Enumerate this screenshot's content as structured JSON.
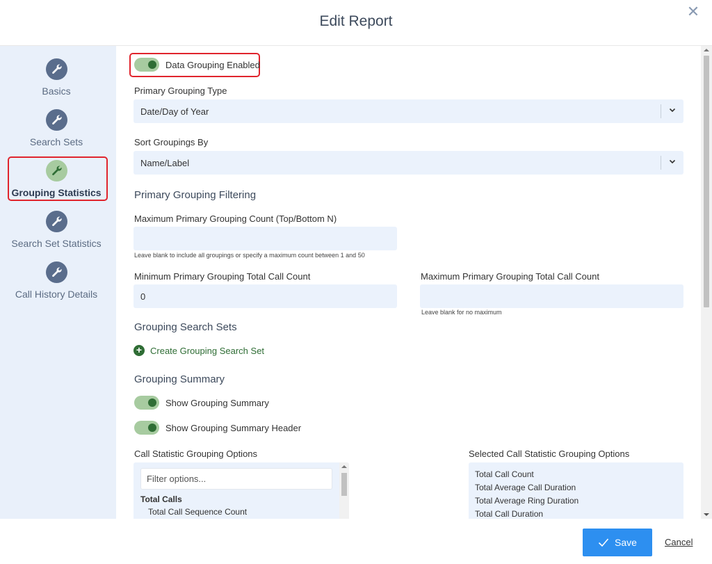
{
  "dialog": {
    "title": "Edit Report",
    "close_icon": "close-icon"
  },
  "sidebar": {
    "items": [
      {
        "label": "Basics",
        "icon": "wrench-icon"
      },
      {
        "label": "Search Sets",
        "icon": "wrench-icon"
      },
      {
        "label": "Grouping Statistics",
        "icon": "wrench-icon",
        "active": true
      },
      {
        "label": "Search Set Statistics",
        "icon": "wrench-icon"
      },
      {
        "label": "Call History Details",
        "icon": "wrench-icon"
      }
    ]
  },
  "main": {
    "data_grouping_toggle": {
      "label": "Data Grouping Enabled",
      "on": true
    },
    "primary_grouping_type": {
      "label": "Primary Grouping Type",
      "value": "Date/Day of Year"
    },
    "sort_groupings_by": {
      "label": "Sort Groupings By",
      "value": "Name/Label"
    },
    "filtering_section_title": "Primary Grouping Filtering",
    "max_count": {
      "label": "Maximum Primary Grouping Count (Top/Bottom N)",
      "value": "",
      "hint": "Leave blank to include all groupings or specify a maximum count between 1 and 50"
    },
    "min_total_call_count": {
      "label": "Minimum Primary Grouping Total Call Count",
      "value": "0"
    },
    "max_total_call_count": {
      "label": "Maximum Primary Grouping Total Call Count",
      "value": "",
      "hint": "Leave blank for no maximum"
    },
    "search_sets_section_title": "Grouping Search Sets",
    "create_search_set_link": "Create Grouping Search Set",
    "summary_section_title": "Grouping Summary",
    "show_summary_toggle": {
      "label": "Show Grouping Summary",
      "on": true
    },
    "show_summary_header_toggle": {
      "label": "Show Grouping Summary Header",
      "on": true
    },
    "options_list": {
      "label": "Call Statistic Grouping Options",
      "filter_placeholder": "Filter options...",
      "group_heading": "Total Calls",
      "items": [
        "Total Call Sequence Count"
      ]
    },
    "selected_list": {
      "label": "Selected Call Statistic Grouping Options",
      "items": [
        "Total Call Count",
        "Total Average Call Duration",
        "Total Average Ring Duration",
        "Total Call Duration"
      ]
    }
  },
  "footer": {
    "save_label": "Save",
    "cancel_label": "Cancel"
  },
  "colors": {
    "accent_green": "#2f6d35",
    "toggle_track": "#a7cba0",
    "primary_blue": "#2d8ff0",
    "field_bg": "#ebf2fc",
    "sidebar_bg": "#e9f0fa",
    "highlight_red": "#e0242d"
  }
}
